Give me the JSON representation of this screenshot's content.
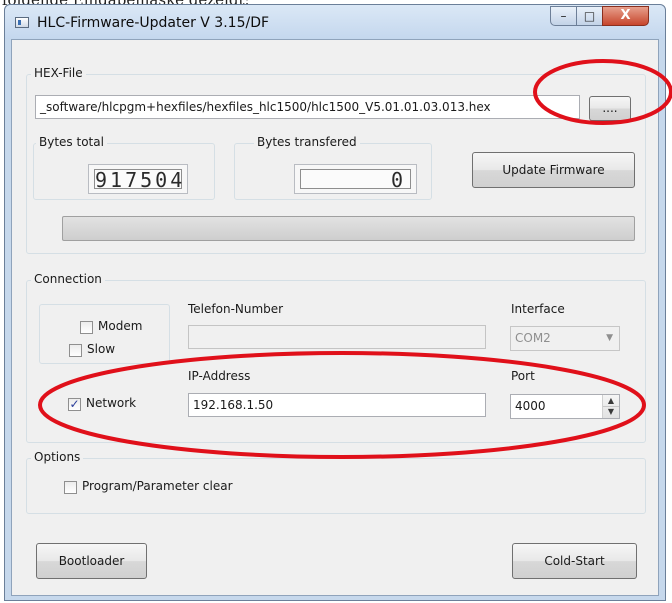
{
  "caption": "folgende Eingabemaske gezeigt:",
  "window": {
    "title": "HLC-Firmware-Updater V 3.15/DF",
    "controls": {
      "minimize": "–",
      "maximize": "□",
      "close": "X"
    }
  },
  "hex_file": {
    "legend": "HEX-File",
    "path": "_software/hlcpgm+hexfiles/hexfiles_hlc1500/hlc1500_V5.01.01.03.013.hex",
    "browse_label": "....",
    "bytes_total_label": "Bytes total",
    "bytes_total_value": "917504",
    "bytes_transfered_label": "Bytes transfered",
    "bytes_transfered_value": "0",
    "update_button": "Update Firmware",
    "progress": 0
  },
  "connection": {
    "legend": "Connection",
    "modem_label": "Modem",
    "slow_label": "Slow",
    "network_label": "Network",
    "modem_checked": false,
    "slow_checked": false,
    "network_checked": true,
    "telefon_label": "Telefon-Number",
    "telefon_value": "",
    "interface_label": "Interface",
    "interface_value": "COM2",
    "ip_label": "IP-Address",
    "ip_value": "192.168.1.50",
    "port_label": "Port",
    "port_value": "4000"
  },
  "options": {
    "legend": "Options",
    "program_clear_label": "Program/Parameter clear",
    "program_clear_checked": false
  },
  "footer": {
    "bootloader_button": "Bootloader",
    "coldstart_button": "Cold-Start"
  },
  "colors": {
    "annotation": "#e0101a",
    "window_frame": "#c6d8ec",
    "check_mark": "#2a3d99"
  },
  "icons": {
    "checkmark": "✓",
    "dropdown": "▼",
    "spin_up": "▲",
    "spin_down": "▼"
  }
}
